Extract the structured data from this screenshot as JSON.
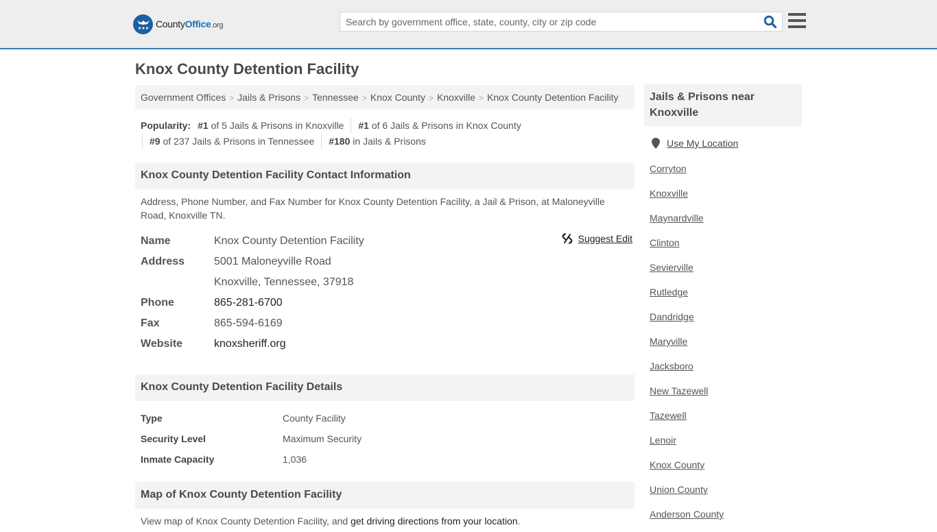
{
  "header": {
    "logo": {
      "county": "County",
      "office": "Office",
      "org": ".org"
    },
    "search_placeholder": "Search by government office, state, county, city or zip code",
    "search_icon": "search-icon",
    "menu_icon": "hamburger-menu-icon"
  },
  "page": {
    "title": "Knox County Detention Facility"
  },
  "breadcrumb": [
    "Government Offices",
    "Jails & Prisons",
    "Tennessee",
    "Knox County",
    "Knoxville",
    "Knox County Detention Facility"
  ],
  "breadcrumb_separator": ">",
  "popularity": {
    "label": "Popularity:",
    "items": [
      {
        "rank": "#1",
        "text": "of 5 Jails & Prisons in Knoxville"
      },
      {
        "rank": "#1",
        "text": "of 6 Jails & Prisons in Knox County"
      },
      {
        "rank": "#9",
        "text": "of 237 Jails & Prisons in Tennessee"
      },
      {
        "rank": "#180",
        "text": "in Jails & Prisons"
      }
    ]
  },
  "contact": {
    "heading": "Knox County Detention Facility Contact Information",
    "description": "Address, Phone Number, and Fax Number for Knox County Detention Facility, a Jail & Prison, at Maloneyville Road, Knoxville TN.",
    "suggest_edit": "Suggest Edit",
    "rows": {
      "name": {
        "label": "Name",
        "value": "Knox County Detention Facility"
      },
      "address": {
        "label": "Address",
        "line1": "5001 Maloneyville Road",
        "line2": "Knoxville, Tennessee, 37918"
      },
      "phone": {
        "label": "Phone",
        "value": "865-281-6700"
      },
      "fax": {
        "label": "Fax",
        "value": "865-594-6169"
      },
      "website": {
        "label": "Website",
        "value": "knoxsheriff.org"
      }
    }
  },
  "details": {
    "heading": "Knox County Detention Facility Details",
    "rows": [
      {
        "label": "Type",
        "value": "County Facility"
      },
      {
        "label": "Security Level",
        "value": "Maximum Security"
      },
      {
        "label": "Inmate Capacity",
        "value": "1,036"
      }
    ]
  },
  "map": {
    "heading": "Map of Knox County Detention Facility",
    "desc_prefix": "View map of Knox County Detention Facility, and ",
    "desc_link": "get driving directions from your location",
    "desc_suffix": "."
  },
  "sidebar": {
    "heading": "Jails & Prisons near Knoxville",
    "use_location": "Use My Location",
    "links": [
      "Corryton",
      "Knoxville",
      "Maynardville",
      "Clinton",
      "Sevierville",
      "Rutledge",
      "Dandridge",
      "Maryville",
      "Jacksboro",
      "New Tazewell",
      "Tazewell",
      "Lenoir",
      "Knox County",
      "Union County",
      "Anderson County"
    ]
  },
  "colors": {
    "brand_blue": "#1f5fa0",
    "header_bg": "#eeeeee",
    "header_border": "#3a7bb0",
    "panel_bg": "#f3f3f3"
  }
}
